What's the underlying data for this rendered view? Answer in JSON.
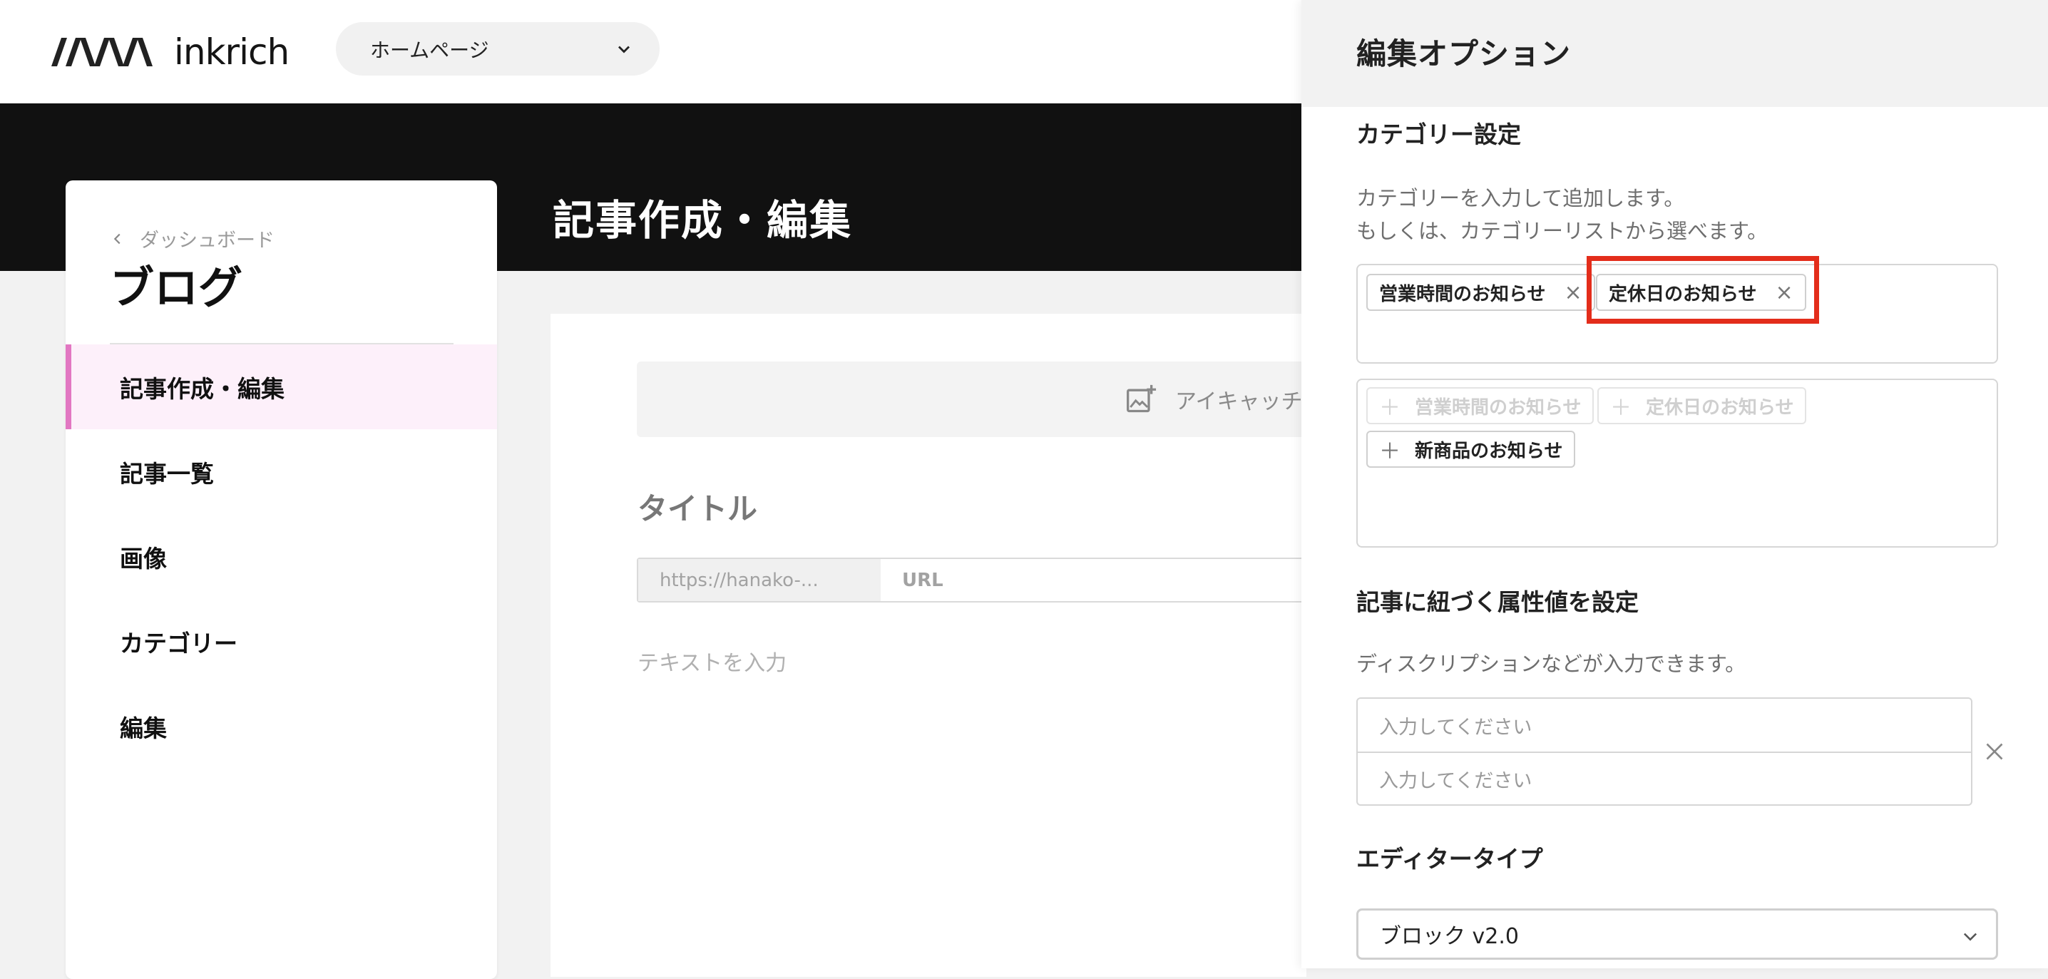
{
  "header": {
    "logo_text": "inkrich",
    "page_select_value": "ホームページ"
  },
  "nav": {
    "breadcrumb": "ダッシュボード",
    "section_title": "ブログ",
    "items": [
      {
        "label": "記事作成・編集",
        "active": true
      },
      {
        "label": "記事一覧"
      },
      {
        "label": "画像"
      },
      {
        "label": "カテゴリー"
      },
      {
        "label": "編集"
      }
    ]
  },
  "main": {
    "title": "記事作成・編集",
    "eyecatch_label": "アイキャッチ",
    "title_placeholder": "タイトル",
    "url_prefix": "https://hanako-...",
    "url_placeholder": "URL",
    "text_placeholder": "テキストを入力"
  },
  "panel": {
    "title": "編集オプション",
    "category": {
      "heading": "カテゴリー設定",
      "help_line1": "カテゴリーを入力して追加します。",
      "help_line2": "もしくは、カテゴリーリストから選べます。",
      "selected": [
        "営業時間のお知らせ",
        "定休日のお知らせ"
      ],
      "choices": [
        {
          "label": "営業時間のお知らせ",
          "disabled": true
        },
        {
          "label": "定休日のお知らせ",
          "disabled": true
        },
        {
          "label": "新商品のお知らせ",
          "disabled": false
        }
      ],
      "remove_symbol": "×",
      "add_symbol": "＋"
    },
    "attributes": {
      "heading": "記事に紐づく属性値を設定",
      "help": "ディスクリプションなどが入力できます。",
      "key_placeholder": "入力してください",
      "value_placeholder": "入力してください"
    },
    "editor_type": {
      "heading": "エディタータイプ",
      "value": "ブロック v2.0"
    }
  },
  "colors": {
    "accent_pink": "#e277c2",
    "active_bg": "#fdf0fa",
    "highlight_red": "#e32d1b",
    "hero_black": "#111111"
  }
}
